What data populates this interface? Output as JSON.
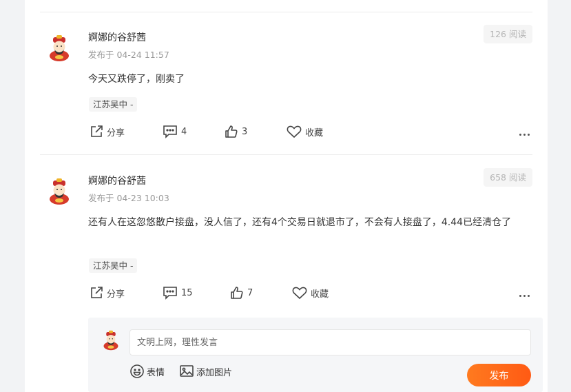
{
  "posts": [
    {
      "username": "婀娜的谷舒茜",
      "time": "发布于 04-24 11:57",
      "reads_count": "126",
      "reads_label": "阅读",
      "content": "今天又跌停了，刚卖了",
      "tag": "江苏吴中 -",
      "share_label": "分享",
      "comments_count": "4",
      "likes_count": "3",
      "favorite_label": "收藏"
    },
    {
      "username": "婀娜的谷舒茜",
      "time": "发布于 04-23 10:03",
      "reads_count": "658",
      "reads_label": "阅读",
      "content": "还有人在这忽悠散户接盘，没人信了，还有4个交易日就退市了，不会有人接盘了，4.44已经清仓了",
      "tag": "江苏吴中 -",
      "share_label": "分享",
      "comments_count": "15",
      "likes_count": "7",
      "favorite_label": "收藏"
    }
  ],
  "composer": {
    "placeholder": "文明上网，理性发言",
    "emoji_label": "表情",
    "image_label": "添加图片",
    "publish_label": "发布"
  },
  "colors": {
    "accent": "#ff6a1a",
    "muted_text": "#999999",
    "background": "#f2f3f5"
  },
  "icons": [
    "avatar-caishen",
    "share-icon",
    "comment-icon",
    "like-icon",
    "heart-icon",
    "more-icon",
    "emoji-icon",
    "image-icon"
  ]
}
